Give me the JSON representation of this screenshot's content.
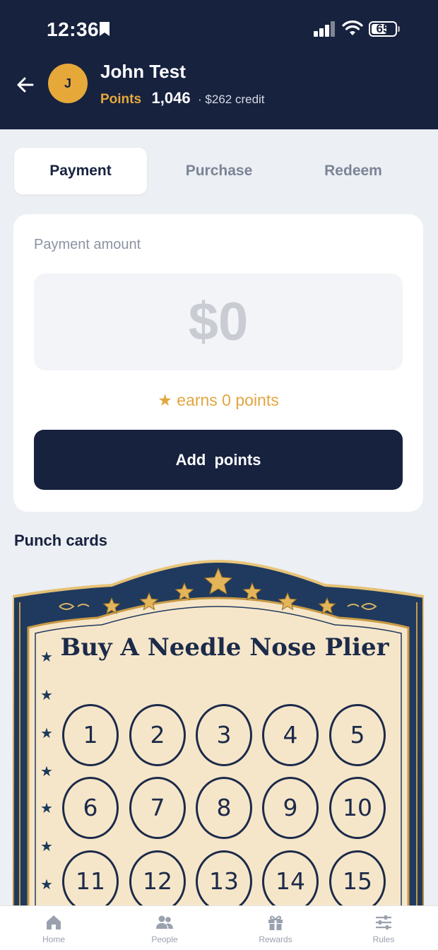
{
  "status_bar": {
    "time": "12:36",
    "battery": "65",
    "battery_level": 0.65
  },
  "header": {
    "avatar_initial": "J",
    "name": "John Test",
    "points_label": "Points",
    "points_value": "1,046",
    "credit": "· $262 credit"
  },
  "tabs": [
    {
      "label": "Payment",
      "active": true
    },
    {
      "label": "Purchase",
      "active": false
    },
    {
      "label": "Redeem",
      "active": false
    }
  ],
  "payment": {
    "label": "Payment amount",
    "amount": "$0",
    "earns": "★ earns 0 points",
    "add_button": "Add points"
  },
  "punch_cards": {
    "section_title": "Punch cards",
    "card_title": "Buy A Needle Nose Plier",
    "punches": [
      "1",
      "2",
      "3",
      "4",
      "5",
      "6",
      "7",
      "8",
      "9",
      "10",
      "11",
      "12",
      "13",
      "14",
      "15"
    ]
  },
  "bottom_nav": [
    {
      "label": "Home",
      "icon": "home-icon"
    },
    {
      "label": "People",
      "icon": "people-icon"
    },
    {
      "label": "Rewards",
      "icon": "gift-icon"
    },
    {
      "label": "Rules",
      "icon": "sliders-icon"
    }
  ],
  "colors": {
    "navy": "#17223f",
    "gold": "#e7a83a",
    "parchment": "#f6e6c9"
  }
}
